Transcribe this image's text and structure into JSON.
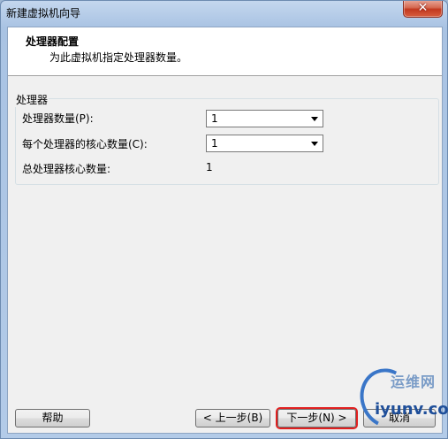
{
  "window": {
    "title": "新建虚拟机向导",
    "close_label": "✕"
  },
  "header": {
    "title": "处理器配置",
    "subtitle": "为此虚拟机指定处理器数量。"
  },
  "processors": {
    "group_label": "处理器",
    "count_label": "处理器数量(P):",
    "count_value": "1",
    "cores_label": "每个处理器的核心数量(C):",
    "cores_value": "1",
    "total_label": "总处理器核心数量:",
    "total_value": "1"
  },
  "buttons": {
    "help": "帮助",
    "back": "< 上一步(B)",
    "next": "下一步(N) >",
    "cancel": "取消"
  },
  "watermark": {
    "line1": "运维网",
    "line2": "iyunv.com"
  },
  "colors": {
    "focus_highlight": "#e02020",
    "close_button": "#c2391f"
  }
}
